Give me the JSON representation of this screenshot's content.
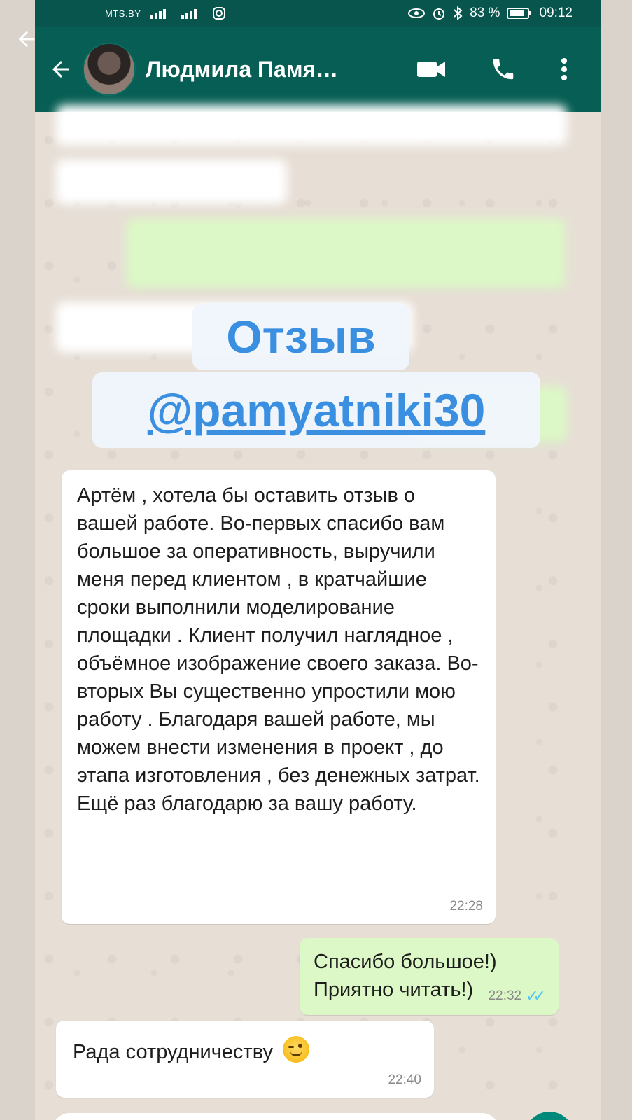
{
  "status_bar": {
    "carrier": "MTS.BY",
    "battery": "83 %",
    "time": "09:12"
  },
  "header": {
    "contact_name": "Людмила Памя…"
  },
  "sticker": {
    "line1": "Отзыв",
    "line2": "@pamyatniki30"
  },
  "messages": [
    {
      "direction": "incoming",
      "text": "Артём , хотела бы оставить отзыв о вашей работе. Во-первых спасибо вам большое за оперативность, выручили меня перед клиентом , в кратчайшие сроки выполнили моделирование площадки . Клиент получил наглядное , объёмное изображение своего заказа. Во-вторых Вы существенно упростили мою работу . Благодаря вашей работе, мы можем внести изменения в проект , до этапа изготовления , без денежных затрат. Ещё раз благодарю за вашу работу.",
      "time": "22:28"
    },
    {
      "direction": "outgoing",
      "text": "Спасибо большое!) Приятно читать!)",
      "time": "22:32"
    },
    {
      "direction": "incoming",
      "text": "Рада сотрудничеству",
      "time": "22:40"
    }
  ],
  "colors": {
    "header": "#075e54",
    "status_bar": "#08554d",
    "outgoing_bubble": "#dcf8c6",
    "incoming_bubble": "#ffffff",
    "sticker_text": "#3a8fe0",
    "read_ticks": "#4fc3f7"
  }
}
